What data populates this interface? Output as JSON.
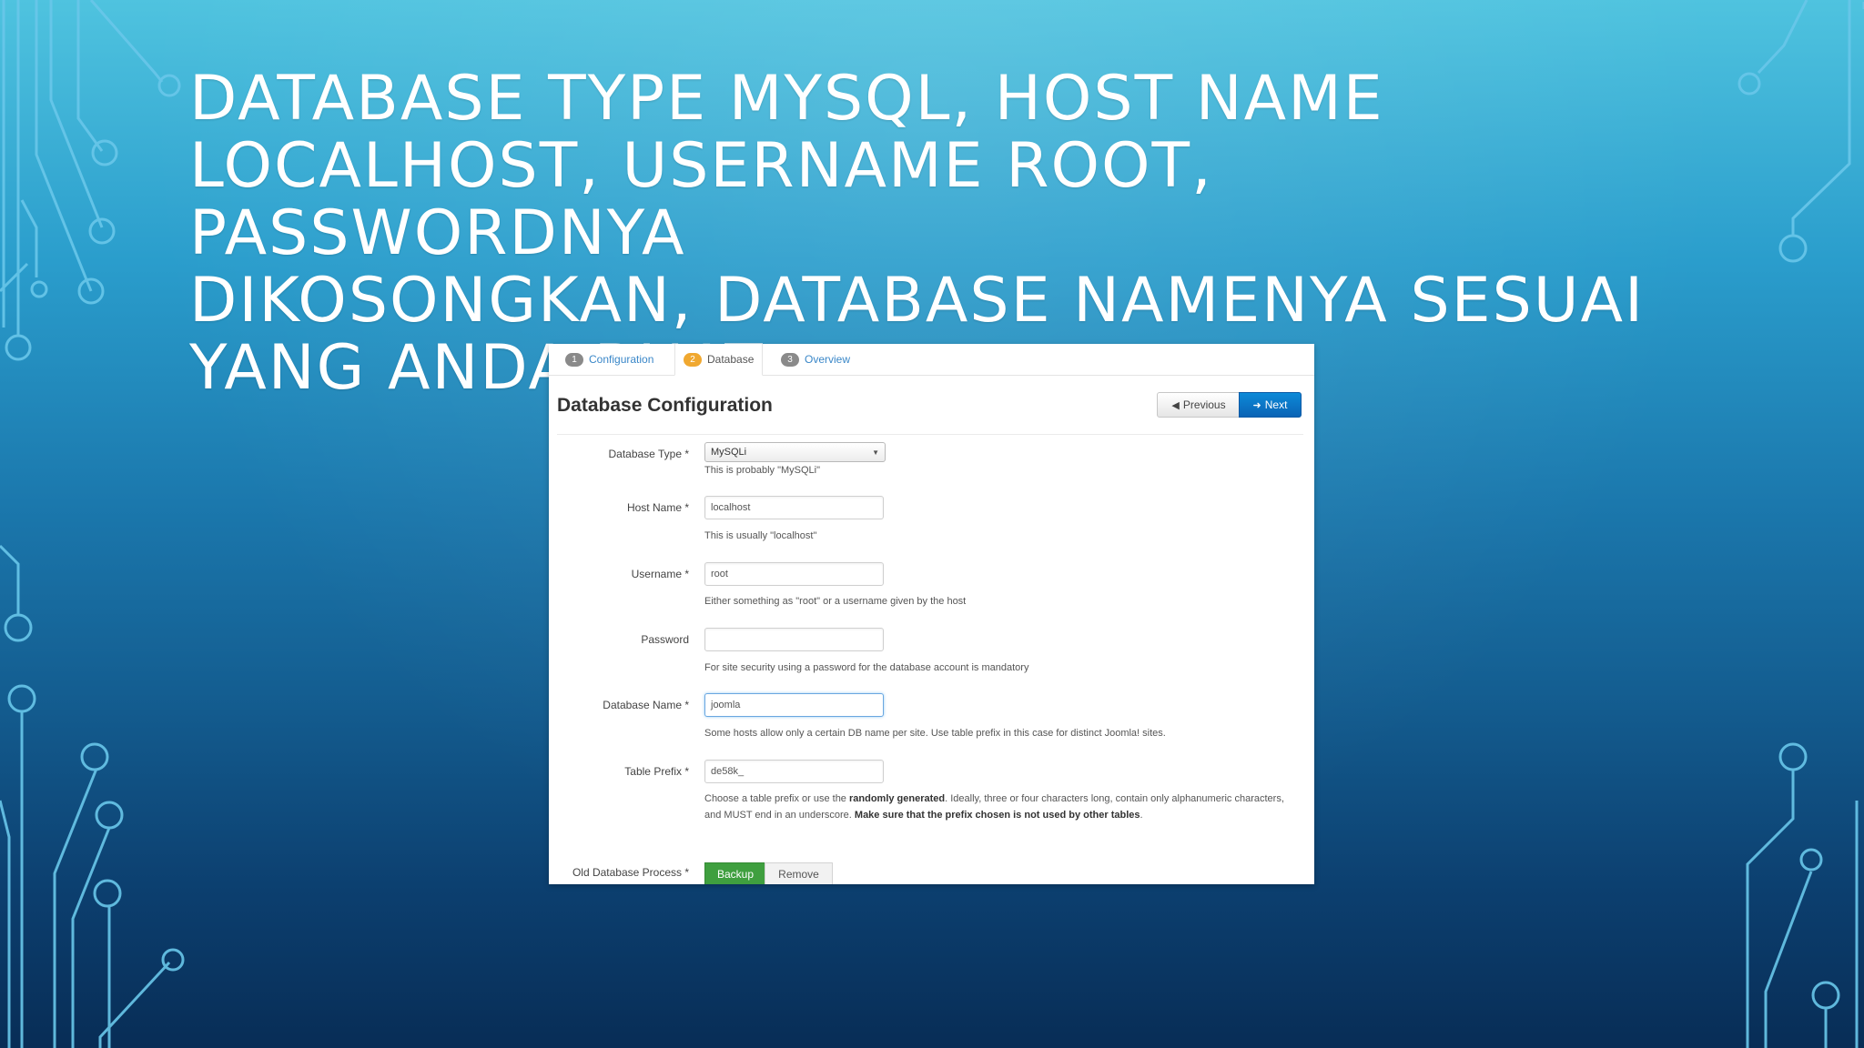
{
  "slide": {
    "title_lines": [
      "DATABASE TYPE MYSQL, HOST NAME",
      "LOCALHOST, USERNAME ROOT, PASSWORDNYA",
      "DIKOSONGKAN, DATABASE NAMENYA SESUAI",
      "YANG ANDA BUAT."
    ]
  },
  "installer": {
    "tabs": [
      {
        "num": "1",
        "label": "Configuration"
      },
      {
        "num": "2",
        "label": "Database"
      },
      {
        "num": "3",
        "label": "Overview"
      }
    ],
    "active_tab": "Database",
    "page_title": "Database Configuration",
    "buttons": {
      "previous": "Previous",
      "next": "Next",
      "previous_icon": "arrow-left-icon",
      "next_icon": "arrow-right-icon"
    },
    "fields": {
      "db_type": {
        "label": "Database Type *",
        "value": "MySQLi",
        "help": "This is probably \"MySQLi\""
      },
      "host": {
        "label": "Host Name *",
        "value": "localhost",
        "help": "This is usually \"localhost\""
      },
      "username": {
        "label": "Username *",
        "value": "root",
        "help": "Either something as \"root\" or a username given by the host"
      },
      "password": {
        "label": "Password",
        "value": "",
        "help": "For site security using a password for the database account is mandatory"
      },
      "db_name": {
        "label": "Database Name *",
        "value": "joomla",
        "help": "Some hosts allow only a certain DB name per site. Use table prefix in this case for distinct Joomla! sites."
      },
      "prefix": {
        "label": "Table Prefix *",
        "value": "de58k_",
        "help_part1": "Choose a table prefix or use the ",
        "help_bold1": "randomly generated",
        "help_part2": ". Ideally, three or four characters long, contain only alphanumeric characters, and MUST end in an underscore. ",
        "help_bold2": "Make sure that the prefix chosen is not used by other tables",
        "help_end": "."
      },
      "old_db": {
        "label": "Old Database Process *",
        "option_backup": "Backup",
        "option_remove": "Remove",
        "selected": "Backup"
      }
    }
  },
  "colors": {
    "accent_blue": "#0a63b5",
    "active_tab_badge": "#f0a830",
    "backup_green": "#3f9f3f",
    "circuit_line": "#69c7ea"
  }
}
